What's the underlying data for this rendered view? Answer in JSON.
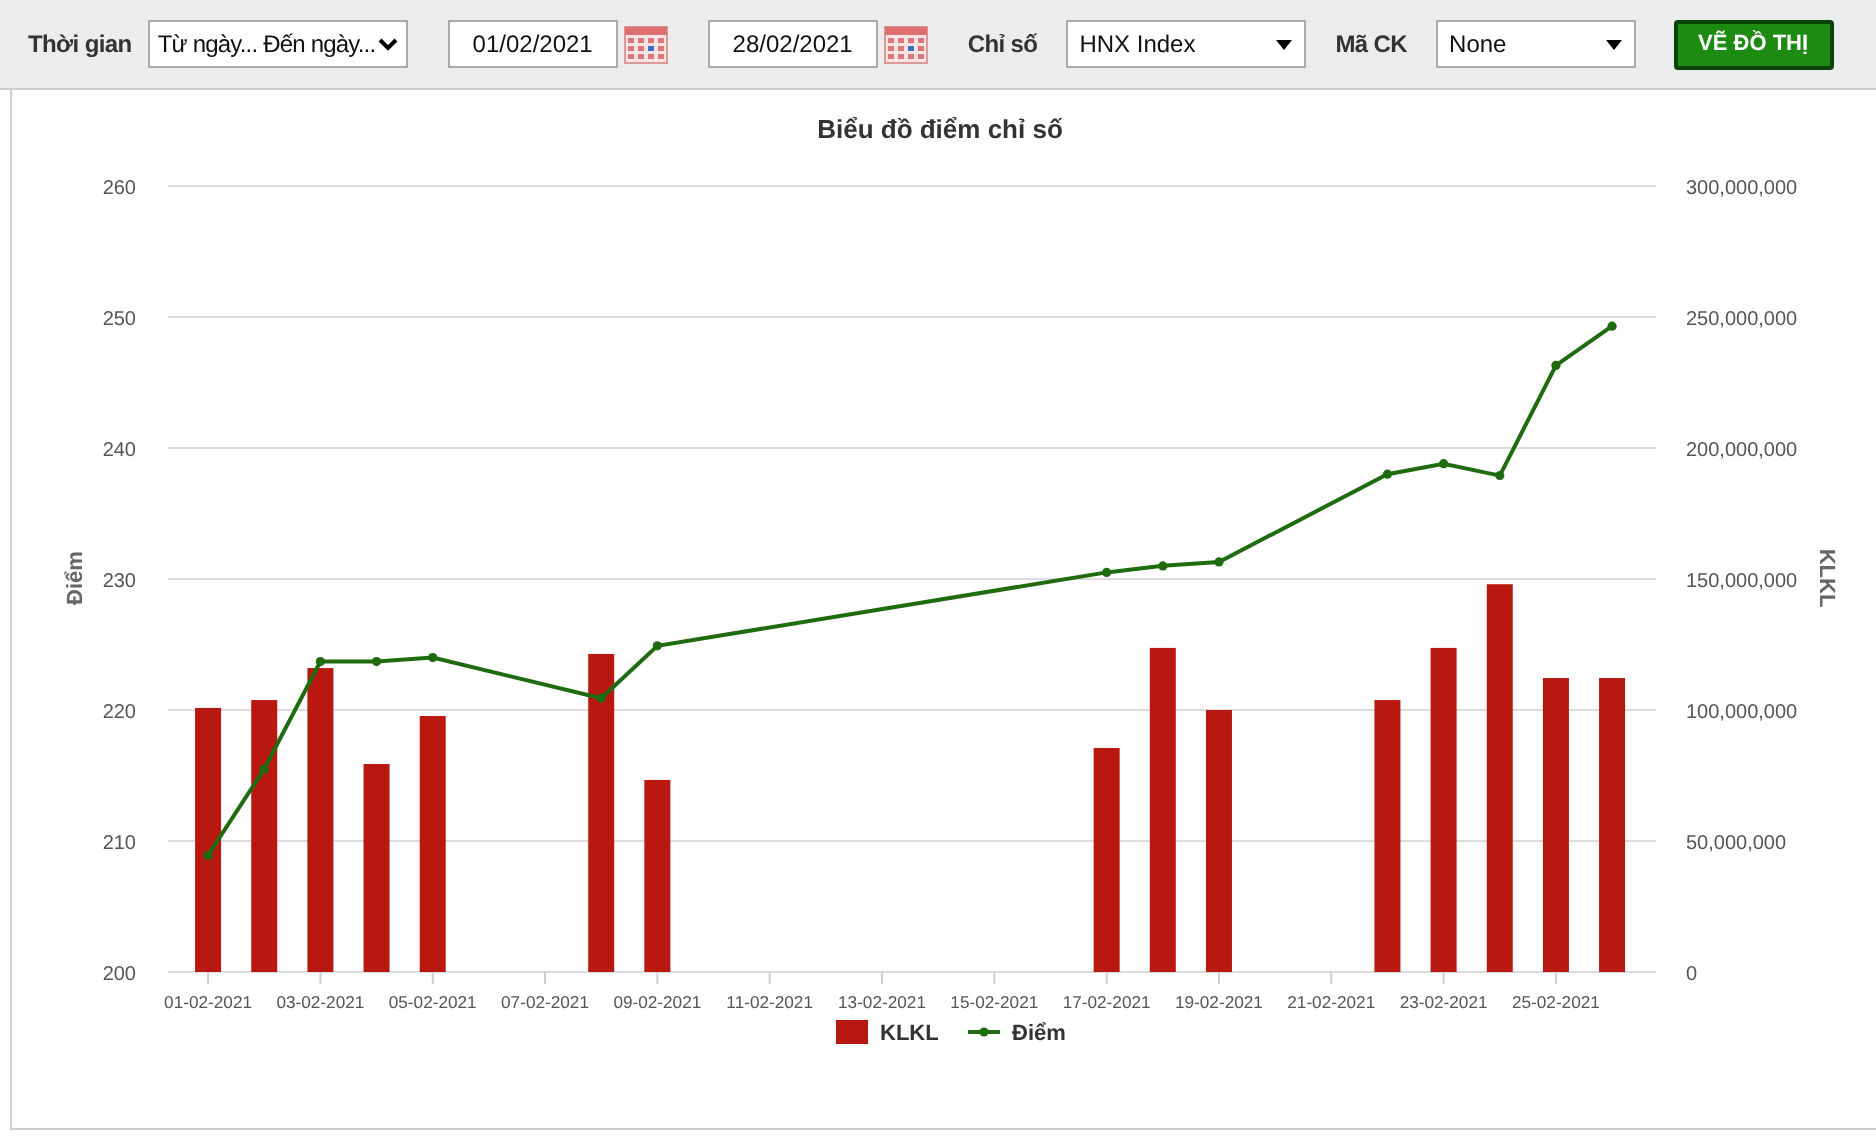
{
  "toolbar": [
    {
      "kind": "label",
      "text": "Thời gian"
    },
    {
      "kind": "native-select",
      "value": "Từ ngày... Đến ngày..."
    },
    {
      "kind": "date",
      "value": "01/02/2021"
    },
    {
      "kind": "date",
      "value": "28/02/2021"
    },
    {
      "kind": "label",
      "text": "Chỉ số"
    },
    {
      "kind": "select",
      "value": "HNX Index"
    },
    {
      "kind": "label",
      "text": "Mã CK"
    },
    {
      "kind": "select",
      "value": "None"
    },
    {
      "kind": "button",
      "text": "VẼ ĐỒ THỊ"
    }
  ],
  "chart": {
    "chart_data": {
      "type": "bar",
      "title": "Biểu đồ điểm chỉ số",
      "ylabel": "Điểm",
      "y2label": "KLKL",
      "stacked": false,
      "grid": true,
      "legend": "bottom",
      "categories": [
        "01-02-2021",
        null,
        "03-02-2021",
        null,
        "05-02-2021",
        null,
        "07-02-2021",
        null,
        "09-02-2021",
        null,
        "11-02-2021",
        null,
        "13-02-2021",
        null,
        "15-02-2021",
        null,
        "17-02-2021",
        null,
        "19-02-2021",
        null,
        "21-02-2021",
        null,
        "23-02-2021",
        null,
        "25-02-2021",
        null
      ],
      "ylim": [
        200,
        260
      ],
      "yticks": [
        200,
        210,
        220,
        230,
        240,
        250,
        260
      ],
      "y2lim": [
        0,
        300000000
      ],
      "y2ticks": [
        {
          "value": 0,
          "label": "0"
        },
        {
          "value": 50000000,
          "label": "50,000,000"
        },
        {
          "value": 100000000,
          "label": "100,000,000"
        },
        {
          "value": 150000000,
          "label": "150,000,000"
        },
        {
          "value": 200000000,
          "label": "200,000,000"
        },
        {
          "value": 250000000,
          "label": "250,000,000"
        },
        {
          "value": 300000000,
          "label": "300,000,000"
        }
      ],
      "series": [
        {
          "name": "KLKL",
          "type": "bar",
          "axis": "y2",
          "color": "#b8180f",
          "values": [
            100800000,
            103800000,
            116000000,
            79400000,
            97700000,
            null,
            null,
            121400000,
            73300000,
            null,
            null,
            null,
            null,
            null,
            null,
            null,
            85500000,
            123700000,
            100000000,
            null,
            null,
            103800000,
            123700000,
            148000000,
            112200000,
            112200000
          ]
        },
        {
          "name": "Điểm",
          "type": "line",
          "marker": "circle",
          "color": "#1f6b10",
          "values": [
            208.9,
            215.5,
            223.7,
            223.7,
            224.0,
            null,
            null,
            220.9,
            224.9,
            null,
            null,
            null,
            null,
            null,
            null,
            null,
            230.5,
            231.0,
            231.3,
            null,
            null,
            238.0,
            238.8,
            237.9,
            246.3,
            249.3
          ]
        }
      ]
    }
  }
}
